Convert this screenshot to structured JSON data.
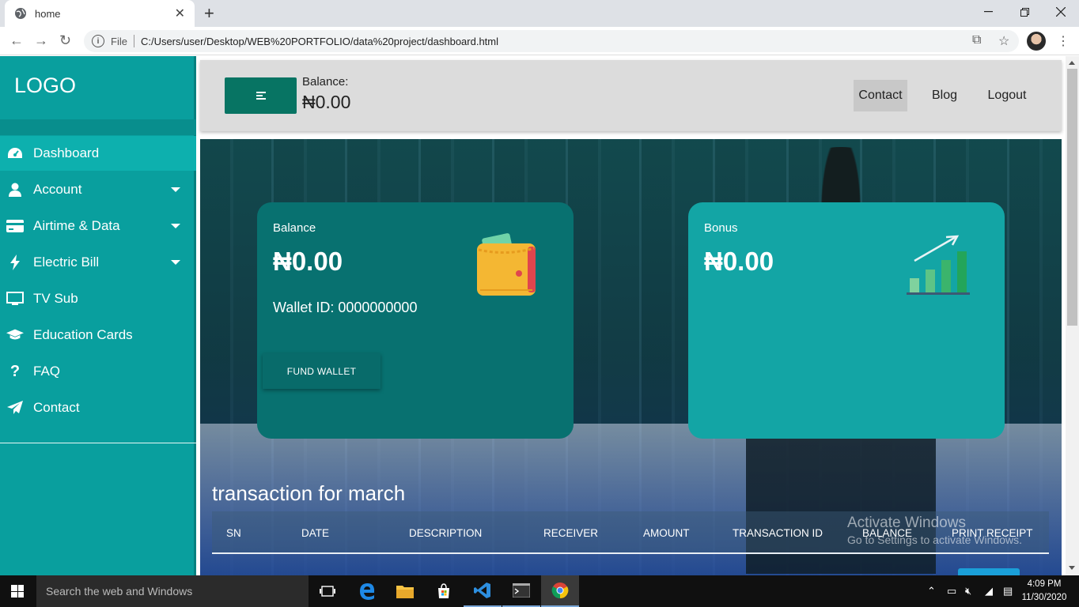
{
  "browser": {
    "tab_title": "home",
    "new_tab": "+",
    "file_label": "File",
    "url": "C:/Users/user/Desktop/WEB%20PORTFOLIO/data%20project/dashboard.html"
  },
  "sidebar": {
    "logo": "LOGO",
    "items": [
      {
        "label": "Dashboard",
        "icon": "dashboard-icon"
      },
      {
        "label": "Account",
        "icon": "user-icon"
      },
      {
        "label": "Airtime & Data",
        "icon": "card-icon"
      },
      {
        "label": "Electric Bill",
        "icon": "bolt-icon"
      },
      {
        "label": "TV Sub",
        "icon": "tv-icon"
      },
      {
        "label": "Education Cards",
        "icon": "graduation-cap-icon"
      },
      {
        "label": "FAQ",
        "icon": "question-icon"
      },
      {
        "label": "Contact",
        "icon": "paper-plane-icon"
      }
    ]
  },
  "topnav": {
    "balance_label": "Balance:",
    "balance_value": "₦0.00",
    "links": [
      "Contact",
      "Blog",
      "Logout"
    ]
  },
  "cards": {
    "balance": {
      "title": "Balance",
      "amount": "₦0.00",
      "wallet_id": "Wallet ID: 0000000000",
      "button": "FUND WALLET"
    },
    "bonus": {
      "title": "Bonus",
      "amount": "₦0.00"
    }
  },
  "transactions": {
    "title": "transaction for march",
    "columns": [
      "SN",
      "DATE",
      "DESCRIPTION",
      "RECEIVER",
      "AMOUNT",
      "TRANSACTION ID",
      "BALANCE",
      "PRINT RECEIPT"
    ]
  },
  "watermark": {
    "line1": "Activate Windows",
    "line2": "Go to Settings to activate Windows."
  },
  "taskbar": {
    "search_placeholder": "Search the web and Windows",
    "time": "4:09 PM",
    "date": "11/30/2020"
  },
  "colors": {
    "sidebar": "#099f9e",
    "balance_card": "#087170",
    "bonus_card": "#13a5a5",
    "toggle_button": "#077463"
  }
}
